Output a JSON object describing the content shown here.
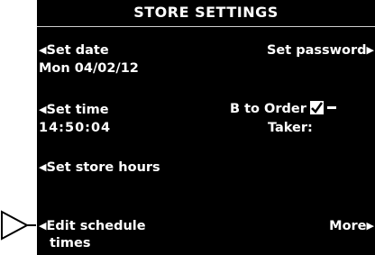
{
  "screen": {
    "title": "STORE SETTINGS"
  },
  "menu": {
    "set_date": {
      "label": "Set date",
      "value": "Mon 04/02/12"
    },
    "set_password": {
      "label": "Set password"
    },
    "set_time": {
      "label": "Set time",
      "value": "14:50:04"
    },
    "b_to_order_taker": {
      "label_line1": "B to Order",
      "label_line2": "Taker:",
      "checked": true
    },
    "set_store_hours": {
      "label": "Set store hours"
    },
    "edit_schedule_times": {
      "label_line1": "Edit schedule",
      "label_line2": "times"
    },
    "more": {
      "label": "More"
    }
  },
  "icons": {
    "left_arrow": "◀",
    "right_arrow": "▶",
    "pointer": "pointer-arrow-icon"
  },
  "colors": {
    "screen_background": "#000000",
    "text": "#ffffff"
  }
}
